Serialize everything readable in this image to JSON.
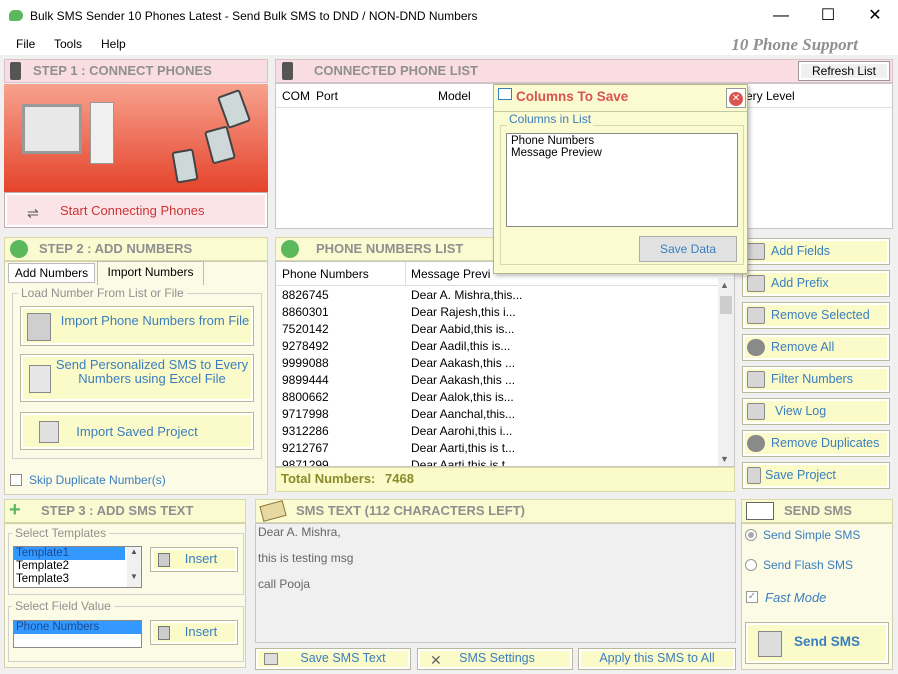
{
  "window": {
    "title": "Bulk SMS Sender 10 Phones Latest - Send Bulk SMS to DND / NON-DND Numbers",
    "minimize": "—",
    "maximize": "☐",
    "close": "✕"
  },
  "menu": {
    "file": "File",
    "tools": "Tools",
    "help": "Help",
    "support": "10 Phone Support"
  },
  "step1": {
    "title": "STEP 1 : CONNECT PHONES",
    "connect_button": "Start Connecting Phones"
  },
  "connected": {
    "title": "CONNECTED PHONE LIST",
    "refresh": "Refresh List",
    "columns": [
      "COM",
      "Port",
      "Model",
      "ery Level"
    ]
  },
  "popup": {
    "title": "Columns To Save",
    "group": "Columns in List",
    "items": [
      "Phone Numbers",
      "Message Preview"
    ],
    "save": "Save Data"
  },
  "step2": {
    "title": "STEP 2 : ADD NUMBERS",
    "tab_add": "Add Numbers",
    "tab_import": "Import Numbers",
    "group": "Load Number From List or File",
    "btn_import_file": "Import Phone Numbers from File",
    "btn_excel": "Send Personalized SMS to Every Numbers using Excel File",
    "btn_project": "Import Saved Project",
    "skip_dup": "Skip Duplicate Number(s)"
  },
  "numbers": {
    "title": "PHONE NUMBERS LIST",
    "col_phone": "Phone Numbers",
    "col_msg": "Message Previ",
    "rows": [
      [
        "8826745",
        "Dear A. Mishra,this..."
      ],
      [
        "8860301",
        "Dear Rajesh,this i..."
      ],
      [
        "7520142",
        "Dear Aabid,this is..."
      ],
      [
        "9278492",
        "Dear Aadil,this is..."
      ],
      [
        "9999088",
        "Dear Aakash,this ..."
      ],
      [
        "9899444",
        "Dear Aakash,this ..."
      ],
      [
        "8800662",
        "Dear Aalok,this is..."
      ],
      [
        "9717998",
        "Dear Aanchal,this..."
      ],
      [
        "9312286",
        "Dear Aarohi,this i..."
      ],
      [
        "9212767",
        "Dear Aarti,this is t..."
      ],
      [
        "9871299",
        "Dear Aarti,this is t..."
      ]
    ],
    "total_label": "Total Numbers:",
    "total_value": "7468"
  },
  "side": {
    "add_fields": "Add Fields",
    "add_prefix": "Add Prefix",
    "remove_selected": "Remove Selected",
    "remove_all": "Remove All",
    "filter": "Filter Numbers",
    "view_log": "View Log",
    "remove_dup": "Remove Duplicates",
    "save_project": "Save Project"
  },
  "step3": {
    "title": "STEP 3 : ADD SMS TEXT",
    "templates_label": "Select Templates",
    "templates": [
      "Template1",
      "Template2",
      "Template3"
    ],
    "insert": "Insert",
    "field_label": "Select Field Value",
    "fields": [
      "Phone Numbers"
    ],
    "insert2": "Insert"
  },
  "smstext": {
    "title": "SMS TEXT (112 CHARACTERS LEFT)",
    "lines": [
      "Dear A. Mishra,",
      "this is testing msg",
      "call Pooja"
    ],
    "save": "Save SMS Text",
    "settings": "SMS Settings",
    "apply": "Apply this SMS to All"
  },
  "send": {
    "title": "SEND SMS",
    "simple": "Send Simple SMS",
    "flash": "Send Flash SMS",
    "fast": "Fast Mode",
    "send_btn": "Send SMS"
  }
}
